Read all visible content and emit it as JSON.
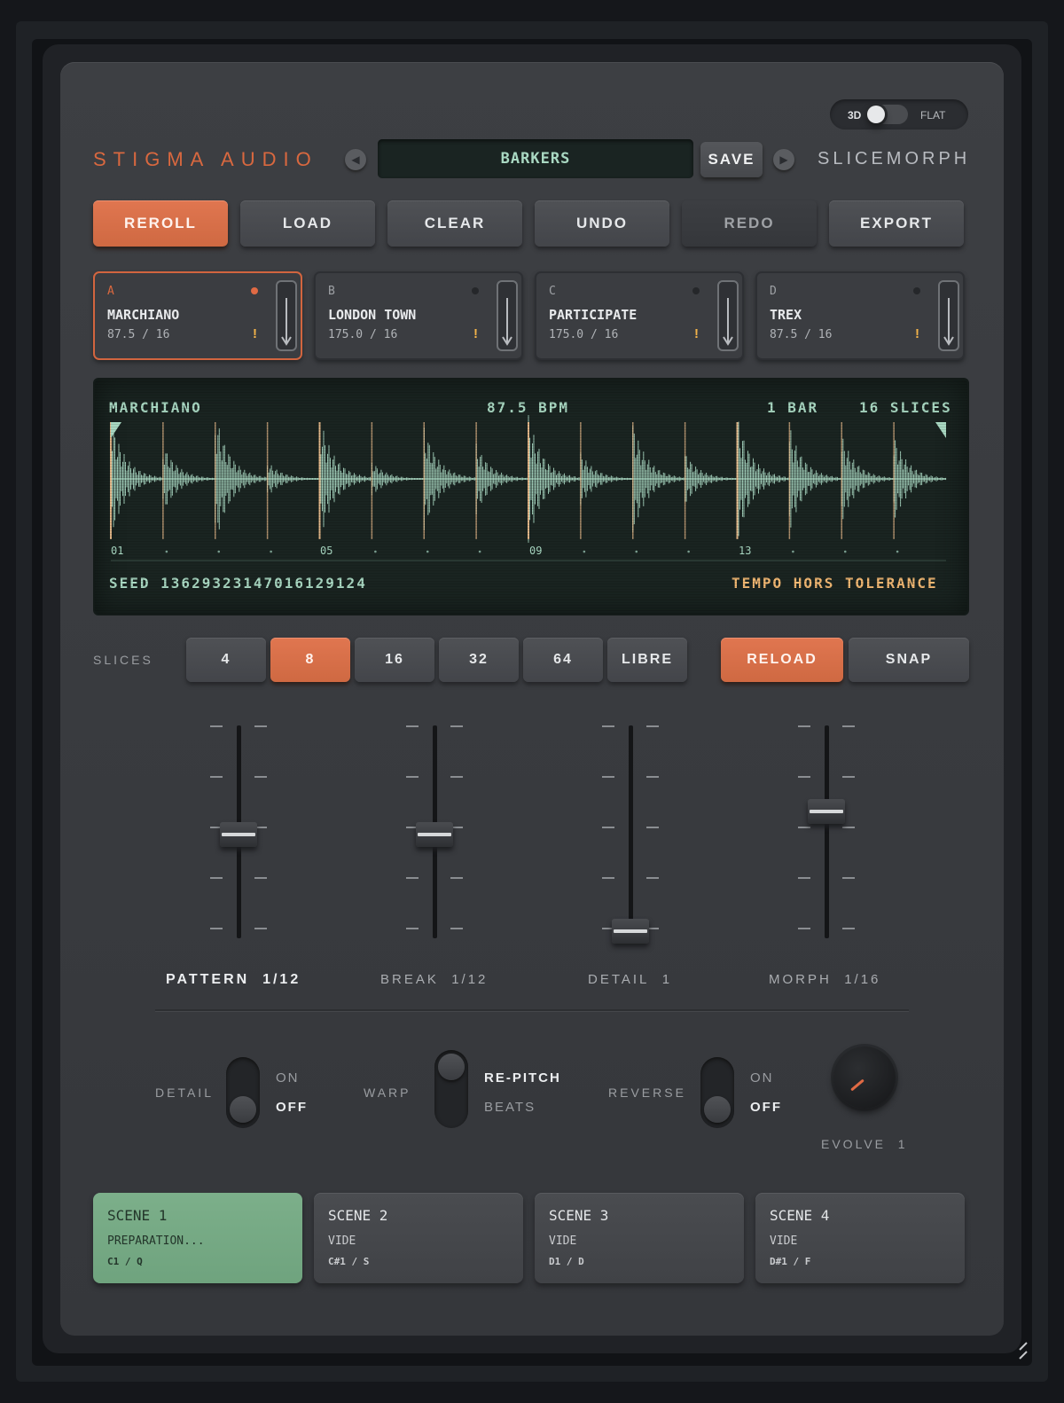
{
  "view_toggle": {
    "left": "3D",
    "right": "FLAT"
  },
  "header": {
    "brand": "STIGMA AUDIO",
    "preset_name": "BARKERS",
    "save_label": "SAVE",
    "product": "SLICEMORPH"
  },
  "toolbar": {
    "reroll": "REROLL",
    "load": "LOAD",
    "clear": "CLEAR",
    "undo": "UNDO",
    "redo": "REDO",
    "export": "EXPORT"
  },
  "slots": [
    {
      "letter": "A",
      "name": "MARCHIANO",
      "meta": "87.5 / 16",
      "warn": "!"
    },
    {
      "letter": "B",
      "name": "LONDON TOWN",
      "meta": "175.0 / 16",
      "warn": "!"
    },
    {
      "letter": "C",
      "name": "PARTICIPATE",
      "meta": "175.0 / 16",
      "warn": "!"
    },
    {
      "letter": "D",
      "name": "TREX",
      "meta": "87.5 / 16",
      "warn": "!"
    }
  ],
  "waveform": {
    "sample": "MARCHIANO",
    "bpm": "87.5 BPM",
    "bars": "1 BAR",
    "slices": "16 SLICES",
    "seed": "SEED 1362932314701612912​4",
    "warning": "TEMPO HORS TOLERANCE",
    "markers": [
      "01",
      "05",
      "09",
      "13"
    ],
    "colors": {
      "wave": "#a9d8c2",
      "slice_line": "#e7b98a",
      "bg": "#1a2421"
    }
  },
  "slices": {
    "label": "SLICES",
    "options": [
      "4",
      "8",
      "16",
      "32",
      "64",
      "LIBRE"
    ],
    "selected": "8",
    "reload": "RELOAD",
    "snap": "SNAP"
  },
  "faders": [
    {
      "label": "PATTERN",
      "value": "1/12",
      "level": 0.5
    },
    {
      "label": "BREAK",
      "value": "1/12",
      "level": 0.5
    },
    {
      "label": "DETAIL",
      "value": "1",
      "level": 0.0
    },
    {
      "label": "MORPH",
      "value": "1/16",
      "level": 0.62
    }
  ],
  "switches": {
    "detail": {
      "label": "DETAIL",
      "on": "ON",
      "off": "OFF",
      "state": "OFF"
    },
    "warp": {
      "label": "WARP",
      "top": "RE-PITCH",
      "bottom": "BEATS",
      "state": "RE-PITCH"
    },
    "reverse": {
      "label": "REVERSE",
      "on": "ON",
      "off": "OFF",
      "state": "OFF"
    }
  },
  "evolve": {
    "label": "EVOLVE",
    "value": "1"
  },
  "scenes": [
    {
      "title": "SCENE 1",
      "sub": "PREPARATION...",
      "key": "C1 / Q"
    },
    {
      "title": "SCENE 2",
      "sub": "VIDE",
      "key": "C#1 / S"
    },
    {
      "title": "SCENE 3",
      "sub": "VIDE",
      "key": "D1 / D"
    },
    {
      "title": "SCENE 4",
      "sub": "VIDE",
      "key": "D#1 / F"
    }
  ],
  "accent": "#d9683f"
}
